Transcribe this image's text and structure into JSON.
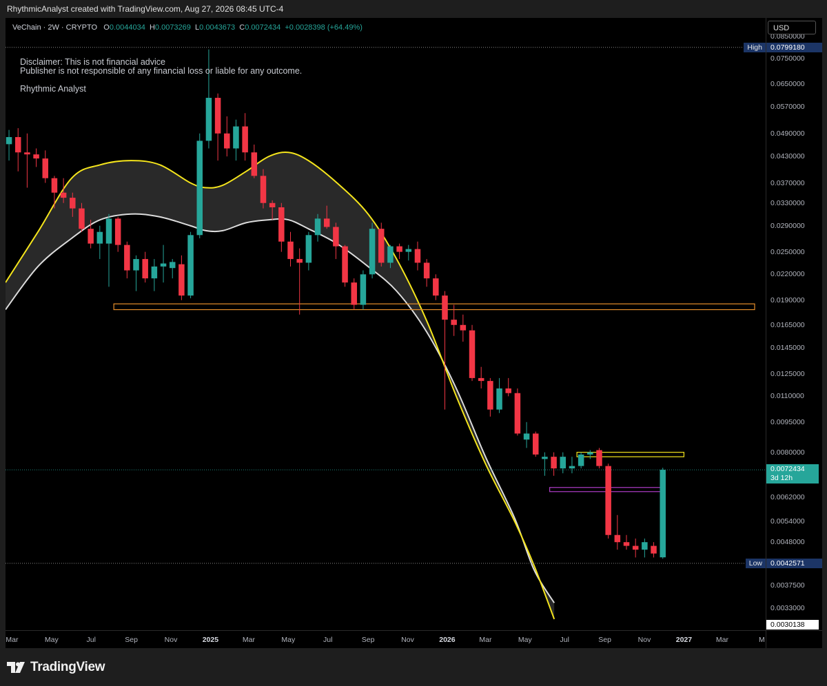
{
  "header": {
    "attribution": "RhythmicAnalyst created with TradingView.com, Aug 27, 2026 08:45 UTC-4"
  },
  "legend": {
    "symbol": "VeChain · 2W · CRYPTO",
    "o_label": "O",
    "o_value": "0.0044034",
    "h_label": "H",
    "h_value": "0.0073269",
    "l_label": "L",
    "l_value": "0.0043673",
    "c_label": "C",
    "c_value": "0.0072434",
    "change": "+0.0028398 (+64.49%)"
  },
  "annotations": {
    "disclaimer_line1": "Disclaimer: This is not financial advice",
    "disclaimer_line2": "Publisher is not responsible of any financial loss or liable for any outcome.",
    "author": "Rhythmic Analyst"
  },
  "currency_button": "USD",
  "footer": {
    "brand": "TradingView"
  },
  "colors": {
    "up": "#26a69a",
    "down": "#f23645",
    "band_upper": "#f5e51c",
    "band_lower": "#dcdcdc",
    "band_fill": "#2e2e2e",
    "zone_orange": "#e8902a",
    "zone_yellow": "#f5e51c",
    "zone_purple": "#b03cc8",
    "tag_blue": "#1c3566"
  },
  "chart_data": {
    "type": "candlestick",
    "title": "",
    "symbol": "VeChain",
    "interval": "2W",
    "scale": "log",
    "ylim": [
      0.00291,
      0.0945
    ],
    "grid": false,
    "price_ticks": [
      "0.0850000",
      "0.0750000",
      "0.0650000",
      "0.0570000",
      "0.0490000",
      "0.0430000",
      "0.0370000",
      "0.0330000",
      "0.0290000",
      "0.0250000",
      "0.0220000",
      "0.0190000",
      "0.0165000",
      "0.0145000",
      "0.0125000",
      "0.0110000",
      "0.0095000",
      "0.0080000",
      "0.0062000",
      "0.0054000",
      "0.0048000",
      "0.0037500",
      "0.0033000"
    ],
    "time_ticks": [
      {
        "label": "Mar",
        "date": "2024-03-01"
      },
      {
        "label": "May",
        "date": "2024-05-01"
      },
      {
        "label": "Jul",
        "date": "2024-07-01"
      },
      {
        "label": "Sep",
        "date": "2024-09-01"
      },
      {
        "label": "Nov",
        "date": "2024-11-01"
      },
      {
        "label": "2025",
        "date": "2025-01-01",
        "year": true
      },
      {
        "label": "Mar",
        "date": "2025-03-01"
      },
      {
        "label": "May",
        "date": "2025-05-01"
      },
      {
        "label": "Jul",
        "date": "2025-07-01"
      },
      {
        "label": "Sep",
        "date": "2025-09-01"
      },
      {
        "label": "Nov",
        "date": "2025-11-01"
      },
      {
        "label": "2026",
        "date": "2026-01-01",
        "year": true
      },
      {
        "label": "Mar",
        "date": "2026-03-01"
      },
      {
        "label": "May",
        "date": "2026-05-01"
      },
      {
        "label": "Jul",
        "date": "2026-07-01"
      },
      {
        "label": "Sep",
        "date": "2026-09-01"
      },
      {
        "label": "Nov",
        "date": "2026-11-01"
      },
      {
        "label": "2027",
        "date": "2027-01-01",
        "year": true
      },
      {
        "label": "Mar",
        "date": "2027-03-01"
      },
      {
        "label": "M",
        "date": "2027-05-01"
      }
    ],
    "x_range": [
      "2024-02-20",
      "2027-05-07"
    ],
    "candles": [
      {
        "d": "2024-02-19",
        "o": 0.0461,
        "h": 0.05,
        "l": 0.042,
        "c": 0.048
      },
      {
        "d": "2024-03-04",
        "o": 0.048,
        "h": 0.0505,
        "l": 0.0395,
        "c": 0.044
      },
      {
        "d": "2024-03-18",
        "o": 0.044,
        "h": 0.049,
        "l": 0.036,
        "c": 0.0435
      },
      {
        "d": "2024-04-01",
        "o": 0.0435,
        "h": 0.045,
        "l": 0.0405,
        "c": 0.0425
      },
      {
        "d": "2024-04-15",
        "o": 0.0425,
        "h": 0.0445,
        "l": 0.037,
        "c": 0.038
      },
      {
        "d": "2024-04-29",
        "o": 0.038,
        "h": 0.0385,
        "l": 0.032,
        "c": 0.035
      },
      {
        "d": "2024-05-13",
        "o": 0.035,
        "h": 0.038,
        "l": 0.033,
        "c": 0.034
      },
      {
        "d": "2024-05-27",
        "o": 0.034,
        "h": 0.035,
        "l": 0.0305,
        "c": 0.032
      },
      {
        "d": "2024-06-10",
        "o": 0.032,
        "h": 0.033,
        "l": 0.028,
        "c": 0.0285
      },
      {
        "d": "2024-06-24",
        "o": 0.0285,
        "h": 0.03,
        "l": 0.0255,
        "c": 0.0262
      },
      {
        "d": "2024-07-08",
        "o": 0.0262,
        "h": 0.029,
        "l": 0.024,
        "c": 0.028
      },
      {
        "d": "2024-07-22",
        "o": 0.0262,
        "h": 0.031,
        "l": 0.0205,
        "c": 0.0302
      },
      {
        "d": "2024-08-05",
        "o": 0.0302,
        "h": 0.0305,
        "l": 0.025,
        "c": 0.026
      },
      {
        "d": "2024-08-19",
        "o": 0.026,
        "h": 0.0265,
        "l": 0.0215,
        "c": 0.0225
      },
      {
        "d": "2024-09-02",
        "o": 0.0225,
        "h": 0.0245,
        "l": 0.02,
        "c": 0.024
      },
      {
        "d": "2024-09-16",
        "o": 0.024,
        "h": 0.025,
        "l": 0.021,
        "c": 0.0215
      },
      {
        "d": "2024-09-30",
        "o": 0.0215,
        "h": 0.024,
        "l": 0.02,
        "c": 0.023
      },
      {
        "d": "2024-10-14",
        "o": 0.023,
        "h": 0.026,
        "l": 0.021,
        "c": 0.0234
      },
      {
        "d": "2024-10-28",
        "o": 0.0228,
        "h": 0.024,
        "l": 0.0215,
        "c": 0.0236
      },
      {
        "d": "2024-11-11",
        "o": 0.0233,
        "h": 0.0245,
        "l": 0.019,
        "c": 0.0195
      },
      {
        "d": "2024-11-25",
        "o": 0.0195,
        "h": 0.028,
        "l": 0.0192,
        "c": 0.0275
      },
      {
        "d": "2024-12-09",
        "o": 0.0275,
        "h": 0.049,
        "l": 0.027,
        "c": 0.047
      },
      {
        "d": "2024-12-23",
        "o": 0.047,
        "h": 0.079,
        "l": 0.045,
        "c": 0.06
      },
      {
        "d": "2025-01-06",
        "o": 0.06,
        "h": 0.0615,
        "l": 0.042,
        "c": 0.049
      },
      {
        "d": "2025-01-20",
        "o": 0.049,
        "h": 0.054,
        "l": 0.043,
        "c": 0.045
      },
      {
        "d": "2025-02-03",
        "o": 0.045,
        "h": 0.053,
        "l": 0.042,
        "c": 0.051
      },
      {
        "d": "2025-02-17",
        "o": 0.051,
        "h": 0.055,
        "l": 0.042,
        "c": 0.044
      },
      {
        "d": "2025-03-03",
        "o": 0.044,
        "h": 0.046,
        "l": 0.038,
        "c": 0.0385
      },
      {
        "d": "2025-03-17",
        "o": 0.0385,
        "h": 0.04,
        "l": 0.032,
        "c": 0.033
      },
      {
        "d": "2025-03-31",
        "o": 0.033,
        "h": 0.0335,
        "l": 0.03,
        "c": 0.0322
      },
      {
        "d": "2025-04-14",
        "o": 0.0322,
        "h": 0.033,
        "l": 0.025,
        "c": 0.0265
      },
      {
        "d": "2025-04-28",
        "o": 0.0265,
        "h": 0.028,
        "l": 0.023,
        "c": 0.024
      },
      {
        "d": "2025-05-12",
        "o": 0.024,
        "h": 0.0255,
        "l": 0.0175,
        "c": 0.0235
      },
      {
        "d": "2025-05-26",
        "o": 0.0235,
        "h": 0.028,
        "l": 0.0225,
        "c": 0.0275
      },
      {
        "d": "2025-06-09",
        "o": 0.0275,
        "h": 0.031,
        "l": 0.0265,
        "c": 0.0302
      },
      {
        "d": "2025-06-23",
        "o": 0.0302,
        "h": 0.0325,
        "l": 0.0285,
        "c": 0.0288
      },
      {
        "d": "2025-07-07",
        "o": 0.0288,
        "h": 0.0295,
        "l": 0.024,
        "c": 0.0258
      },
      {
        "d": "2025-07-21",
        "o": 0.0258,
        "h": 0.026,
        "l": 0.0205,
        "c": 0.021
      },
      {
        "d": "2025-08-04",
        "o": 0.021,
        "h": 0.0215,
        "l": 0.018,
        "c": 0.0185
      },
      {
        "d": "2025-08-18",
        "o": 0.0185,
        "h": 0.0225,
        "l": 0.018,
        "c": 0.022
      },
      {
        "d": "2025-09-01",
        "o": 0.022,
        "h": 0.0295,
        "l": 0.0215,
        "c": 0.0285
      },
      {
        "d": "2025-09-15",
        "o": 0.0285,
        "h": 0.0295,
        "l": 0.023,
        "c": 0.0235
      },
      {
        "d": "2025-09-29",
        "o": 0.0235,
        "h": 0.026,
        "l": 0.0228,
        "c": 0.0258
      },
      {
        "d": "2025-10-13",
        "o": 0.0258,
        "h": 0.0262,
        "l": 0.024,
        "c": 0.025
      },
      {
        "d": "2025-10-27",
        "o": 0.025,
        "h": 0.026,
        "l": 0.0238,
        "c": 0.0254
      },
      {
        "d": "2025-11-10",
        "o": 0.0254,
        "h": 0.0265,
        "l": 0.0225,
        "c": 0.0235
      },
      {
        "d": "2025-11-24",
        "o": 0.0235,
        "h": 0.024,
        "l": 0.0205,
        "c": 0.0215
      },
      {
        "d": "2025-12-08",
        "o": 0.0215,
        "h": 0.022,
        "l": 0.019,
        "c": 0.0195
      },
      {
        "d": "2025-12-22",
        "o": 0.0195,
        "h": 0.02,
        "l": 0.0102,
        "c": 0.017
      },
      {
        "d": "2026-01-05",
        "o": 0.017,
        "h": 0.0185,
        "l": 0.0155,
        "c": 0.0165
      },
      {
        "d": "2026-01-19",
        "o": 0.0165,
        "h": 0.0175,
        "l": 0.015,
        "c": 0.016
      },
      {
        "d": "2026-02-02",
        "o": 0.016,
        "h": 0.0165,
        "l": 0.012,
        "c": 0.0122
      },
      {
        "d": "2026-02-16",
        "o": 0.0122,
        "h": 0.013,
        "l": 0.0115,
        "c": 0.012
      },
      {
        "d": "2026-03-02",
        "o": 0.012,
        "h": 0.0122,
        "l": 0.0098,
        "c": 0.0102
      },
      {
        "d": "2026-03-16",
        "o": 0.0102,
        "h": 0.0122,
        "l": 0.01,
        "c": 0.0115
      },
      {
        "d": "2026-03-30",
        "o": 0.0115,
        "h": 0.0122,
        "l": 0.011,
        "c": 0.0112
      },
      {
        "d": "2026-04-13",
        "o": 0.0112,
        "h": 0.0115,
        "l": 0.0088,
        "c": 0.0089
      },
      {
        "d": "2026-04-27",
        "o": 0.0086,
        "h": 0.0095,
        "l": 0.0082,
        "c": 0.0089
      },
      {
        "d": "2026-05-11",
        "o": 0.0089,
        "h": 0.009,
        "l": 0.0078,
        "c": 0.0079
      },
      {
        "d": "2026-05-25",
        "o": 0.0077,
        "h": 0.008,
        "l": 0.007,
        "c": 0.0078
      },
      {
        "d": "2026-06-08",
        "o": 0.0078,
        "h": 0.008,
        "l": 0.007,
        "c": 0.0073
      },
      {
        "d": "2026-06-22",
        "o": 0.0073,
        "h": 0.008,
        "l": 0.0071,
        "c": 0.0078
      },
      {
        "d": "2026-07-06",
        "o": 0.0073,
        "h": 0.0078,
        "l": 0.0071,
        "c": 0.0074
      },
      {
        "d": "2026-07-20",
        "o": 0.0074,
        "h": 0.008,
        "l": 0.0073,
        "c": 0.0079
      },
      {
        "d": "2026-08-03",
        "o": 0.0079,
        "h": 0.0081,
        "l": 0.0077,
        "c": 0.008
      },
      {
        "d": "2026-08-17",
        "o": 0.0081,
        "h": 0.0082,
        "l": 0.0073,
        "c": 0.0074
      },
      {
        "d": "2026-08-31",
        "o": 0.0074,
        "h": 0.0075,
        "l": 0.0049,
        "c": 0.005
      },
      {
        "d": "2026-09-14",
        "o": 0.005,
        "h": 0.0056,
        "l": 0.0046,
        "c": 0.0048
      },
      {
        "d": "2026-09-28",
        "o": 0.0048,
        "h": 0.005,
        "l": 0.0046,
        "c": 0.0047
      },
      {
        "d": "2026-10-12",
        "o": 0.0047,
        "h": 0.0049,
        "l": 0.0044,
        "c": 0.0046
      },
      {
        "d": "2026-10-26",
        "o": 0.0046,
        "h": 0.0049,
        "l": 0.0044,
        "c": 0.0048
      },
      {
        "d": "2026-11-09",
        "o": 0.0047,
        "h": 0.0048,
        "l": 0.0044,
        "c": 0.0045
      },
      {
        "d": "2026-11-23",
        "o": 0.0044034,
        "h": 0.0073269,
        "l": 0.0043673,
        "c": 0.0072434
      }
    ],
    "band": {
      "upper": [
        [
          "2024-02-20",
          0.021
        ],
        [
          "2024-04-10",
          0.028
        ],
        [
          "2024-06-01",
          0.038
        ],
        [
          "2024-07-15",
          0.041
        ],
        [
          "2024-09-01",
          0.042
        ],
        [
          "2024-10-15",
          0.041
        ],
        [
          "2024-12-01",
          0.037
        ],
        [
          "2024-12-25",
          0.036
        ],
        [
          "2025-01-20",
          0.0365
        ],
        [
          "2025-02-25",
          0.0395
        ],
        [
          "2025-04-01",
          0.043
        ],
        [
          "2025-05-01",
          0.044
        ],
        [
          "2025-06-01",
          0.042
        ],
        [
          "2025-07-15",
          0.037
        ],
        [
          "2025-09-01",
          0.031
        ],
        [
          "2025-10-15",
          0.024
        ],
        [
          "2025-12-01",
          0.0168
        ],
        [
          "2026-01-15",
          0.011
        ],
        [
          "2026-03-01",
          0.0075
        ],
        [
          "2026-04-15",
          0.0054
        ],
        [
          "2026-05-15",
          0.0042
        ],
        [
          "2026-06-15",
          0.0031
        ]
      ],
      "lower": [
        [
          "2024-02-20",
          0.018
        ],
        [
          "2024-04-10",
          0.023
        ],
        [
          "2024-06-01",
          0.027
        ],
        [
          "2024-07-15",
          0.03
        ],
        [
          "2024-09-01",
          0.031
        ],
        [
          "2024-10-15",
          0.0305
        ],
        [
          "2024-12-01",
          0.029
        ],
        [
          "2024-12-25",
          0.0282
        ],
        [
          "2025-01-20",
          0.0282
        ],
        [
          "2025-02-25",
          0.0295
        ],
        [
          "2025-04-01",
          0.03
        ],
        [
          "2025-05-01",
          0.03
        ],
        [
          "2025-06-01",
          0.0285
        ],
        [
          "2025-07-15",
          0.0262
        ],
        [
          "2025-09-01",
          0.023
        ],
        [
          "2025-10-15",
          0.02
        ],
        [
          "2025-12-01",
          0.0158
        ],
        [
          "2026-01-15",
          0.0115
        ],
        [
          "2026-03-01",
          0.0078
        ],
        [
          "2026-04-15",
          0.0055
        ],
        [
          "2026-05-15",
          0.0041
        ],
        [
          "2026-06-15",
          0.0034
        ]
      ]
    },
    "zones": [
      {
        "name": "orange-zone",
        "color": "orange",
        "x0": "2024-08-05",
        "x1": "2027-04-20",
        "y0": 0.018,
        "y1": 0.0186
      },
      {
        "name": "yellow-zone",
        "color": "yellow",
        "x0": "2026-07-20",
        "x1": "2027-01-01",
        "y0": 0.0078,
        "y1": 0.008
      },
      {
        "name": "purple-zone",
        "color": "purple",
        "x0": "2026-06-08",
        "x1": "2026-11-27",
        "y0": 0.0064,
        "y1": 0.00655
      }
    ],
    "high_line": 0.079918,
    "low_line": 0.0042571,
    "last_price": 0.0072434,
    "high_label": "High",
    "high_value": "0.0799180",
    "low_label": "Low",
    "low_value": "0.0042571",
    "last_value": "0.0072434",
    "countdown": "3d 12h",
    "bottom_value": "0.0030138"
  }
}
